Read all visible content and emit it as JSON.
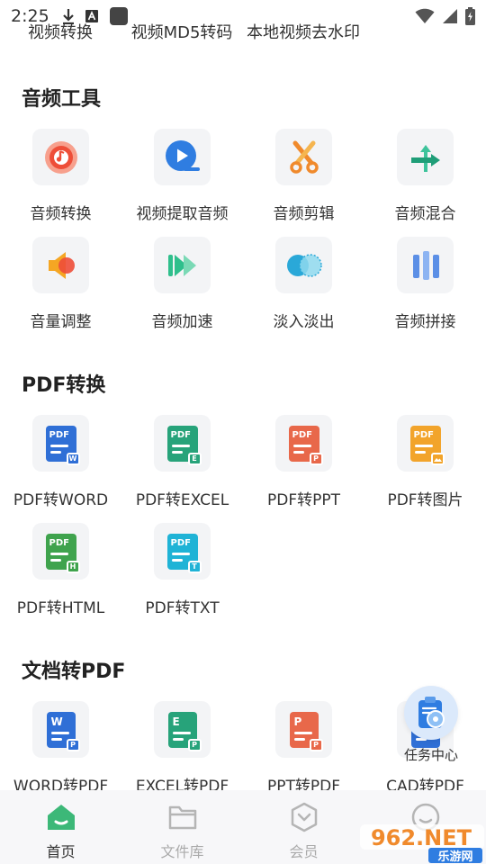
{
  "status_bar": {
    "time": "2:25"
  },
  "previous_row": [
    "视频转换",
    "视频MD5转码",
    "本地视频去水印"
  ],
  "sections": [
    {
      "title": "音频工具",
      "items": [
        {
          "label": "音频转换",
          "icon": "audio-convert-icon"
        },
        {
          "label": "视频提取音频",
          "icon": "video-extract-audio-icon"
        },
        {
          "label": "音频剪辑",
          "icon": "scissors-icon"
        },
        {
          "label": "音频混合",
          "icon": "merge-arrows-icon"
        },
        {
          "label": "音量调整",
          "icon": "speaker-icon"
        },
        {
          "label": "音频加速",
          "icon": "fast-forward-icon"
        },
        {
          "label": "淡入淡出",
          "icon": "fade-circles-icon"
        },
        {
          "label": "音频拼接",
          "icon": "splice-bars-icon"
        }
      ]
    },
    {
      "title": "PDF转换",
      "items": [
        {
          "label": "PDF转WORD",
          "badge": "W",
          "color": "#2f6fd6"
        },
        {
          "label": "PDF转EXCEL",
          "badge": "E",
          "color": "#27a37a"
        },
        {
          "label": "PDF转PPT",
          "badge": "P",
          "color": "#e8684a"
        },
        {
          "label": "PDF转图片",
          "badge": "",
          "color": "#f2a42b"
        },
        {
          "label": "PDF转HTML",
          "badge": "H",
          "color": "#3fa34d"
        },
        {
          "label": "PDF转TXT",
          "badge": "T",
          "color": "#1fb3d6"
        }
      ]
    },
    {
      "title": "文档转PDF",
      "items": [
        {
          "label": "WORD转PDF",
          "letter": "W",
          "color": "#2f6fd6"
        },
        {
          "label": "EXCEL转PDF",
          "letter": "E",
          "color": "#27a37a"
        },
        {
          "label": "PPT转PDF",
          "letter": "P",
          "color": "#e8684a"
        },
        {
          "label": "CAD转PDF",
          "letter": "",
          "color": "#2f6fd6"
        }
      ]
    }
  ],
  "pdf_text": "PDF",
  "pdf_badge_letter": "P",
  "task_center": {
    "label": "任务中心"
  },
  "bottom_nav": [
    {
      "label": "首页",
      "active": true
    },
    {
      "label": "文件库",
      "active": false
    },
    {
      "label": "会员",
      "active": false
    }
  ],
  "watermark": {
    "text_top": "962.NET",
    "text_bottom": "乐游网"
  },
  "colors": {
    "accent": "#3cb878",
    "text": "#333333",
    "tile_bg": "#f3f4f6"
  }
}
